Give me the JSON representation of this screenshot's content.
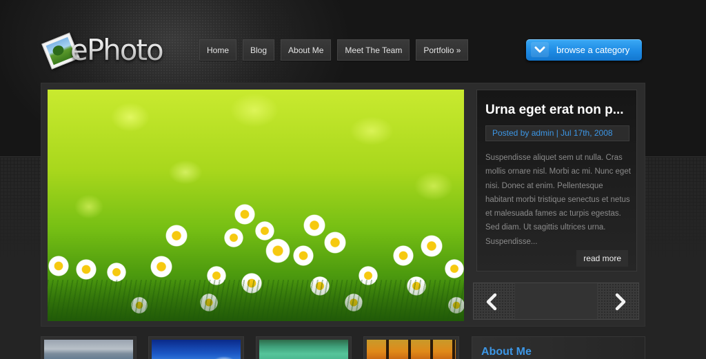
{
  "site": {
    "logo_text": "ePhoto"
  },
  "nav": {
    "items": [
      {
        "label": "Home"
      },
      {
        "label": "Blog"
      },
      {
        "label": "About Me"
      },
      {
        "label": "Meet The Team"
      },
      {
        "label": "Portfolio »"
      }
    ]
  },
  "browse": {
    "label": "browse a category",
    "icon": "chevron-down-icon"
  },
  "featured": {
    "image_alt": "field of daisies",
    "post": {
      "title": "Urna eget erat non p...",
      "meta": "Posted by admin | Jul 17th, 2008",
      "excerpt": "Suspendisse aliquet sem ut nulla. Cras mollis ornare nisl. Morbi ac mi. Nunc eget nisi. Donec at enim. Pellentesque habitant morbi tristique senectus et netus et malesuada fames ac turpis egestas. Sed diam. Ut sagittis ultrices urna. Suspendisse...",
      "read_more": "read more"
    },
    "slider": {
      "prev_icon": "chevron-left-icon",
      "next_icon": "chevron-right-icon"
    }
  },
  "thumbnails": [
    {
      "subject": "mountains"
    },
    {
      "subject": "blue sky"
    },
    {
      "subject": "lagoon"
    },
    {
      "subject": "autumn forest"
    }
  ],
  "sidebar": {
    "about_title": "About Me"
  },
  "colors": {
    "accent_blue": "#3d97e6",
    "button_blue": "#1e8be4",
    "background": "#242424"
  }
}
